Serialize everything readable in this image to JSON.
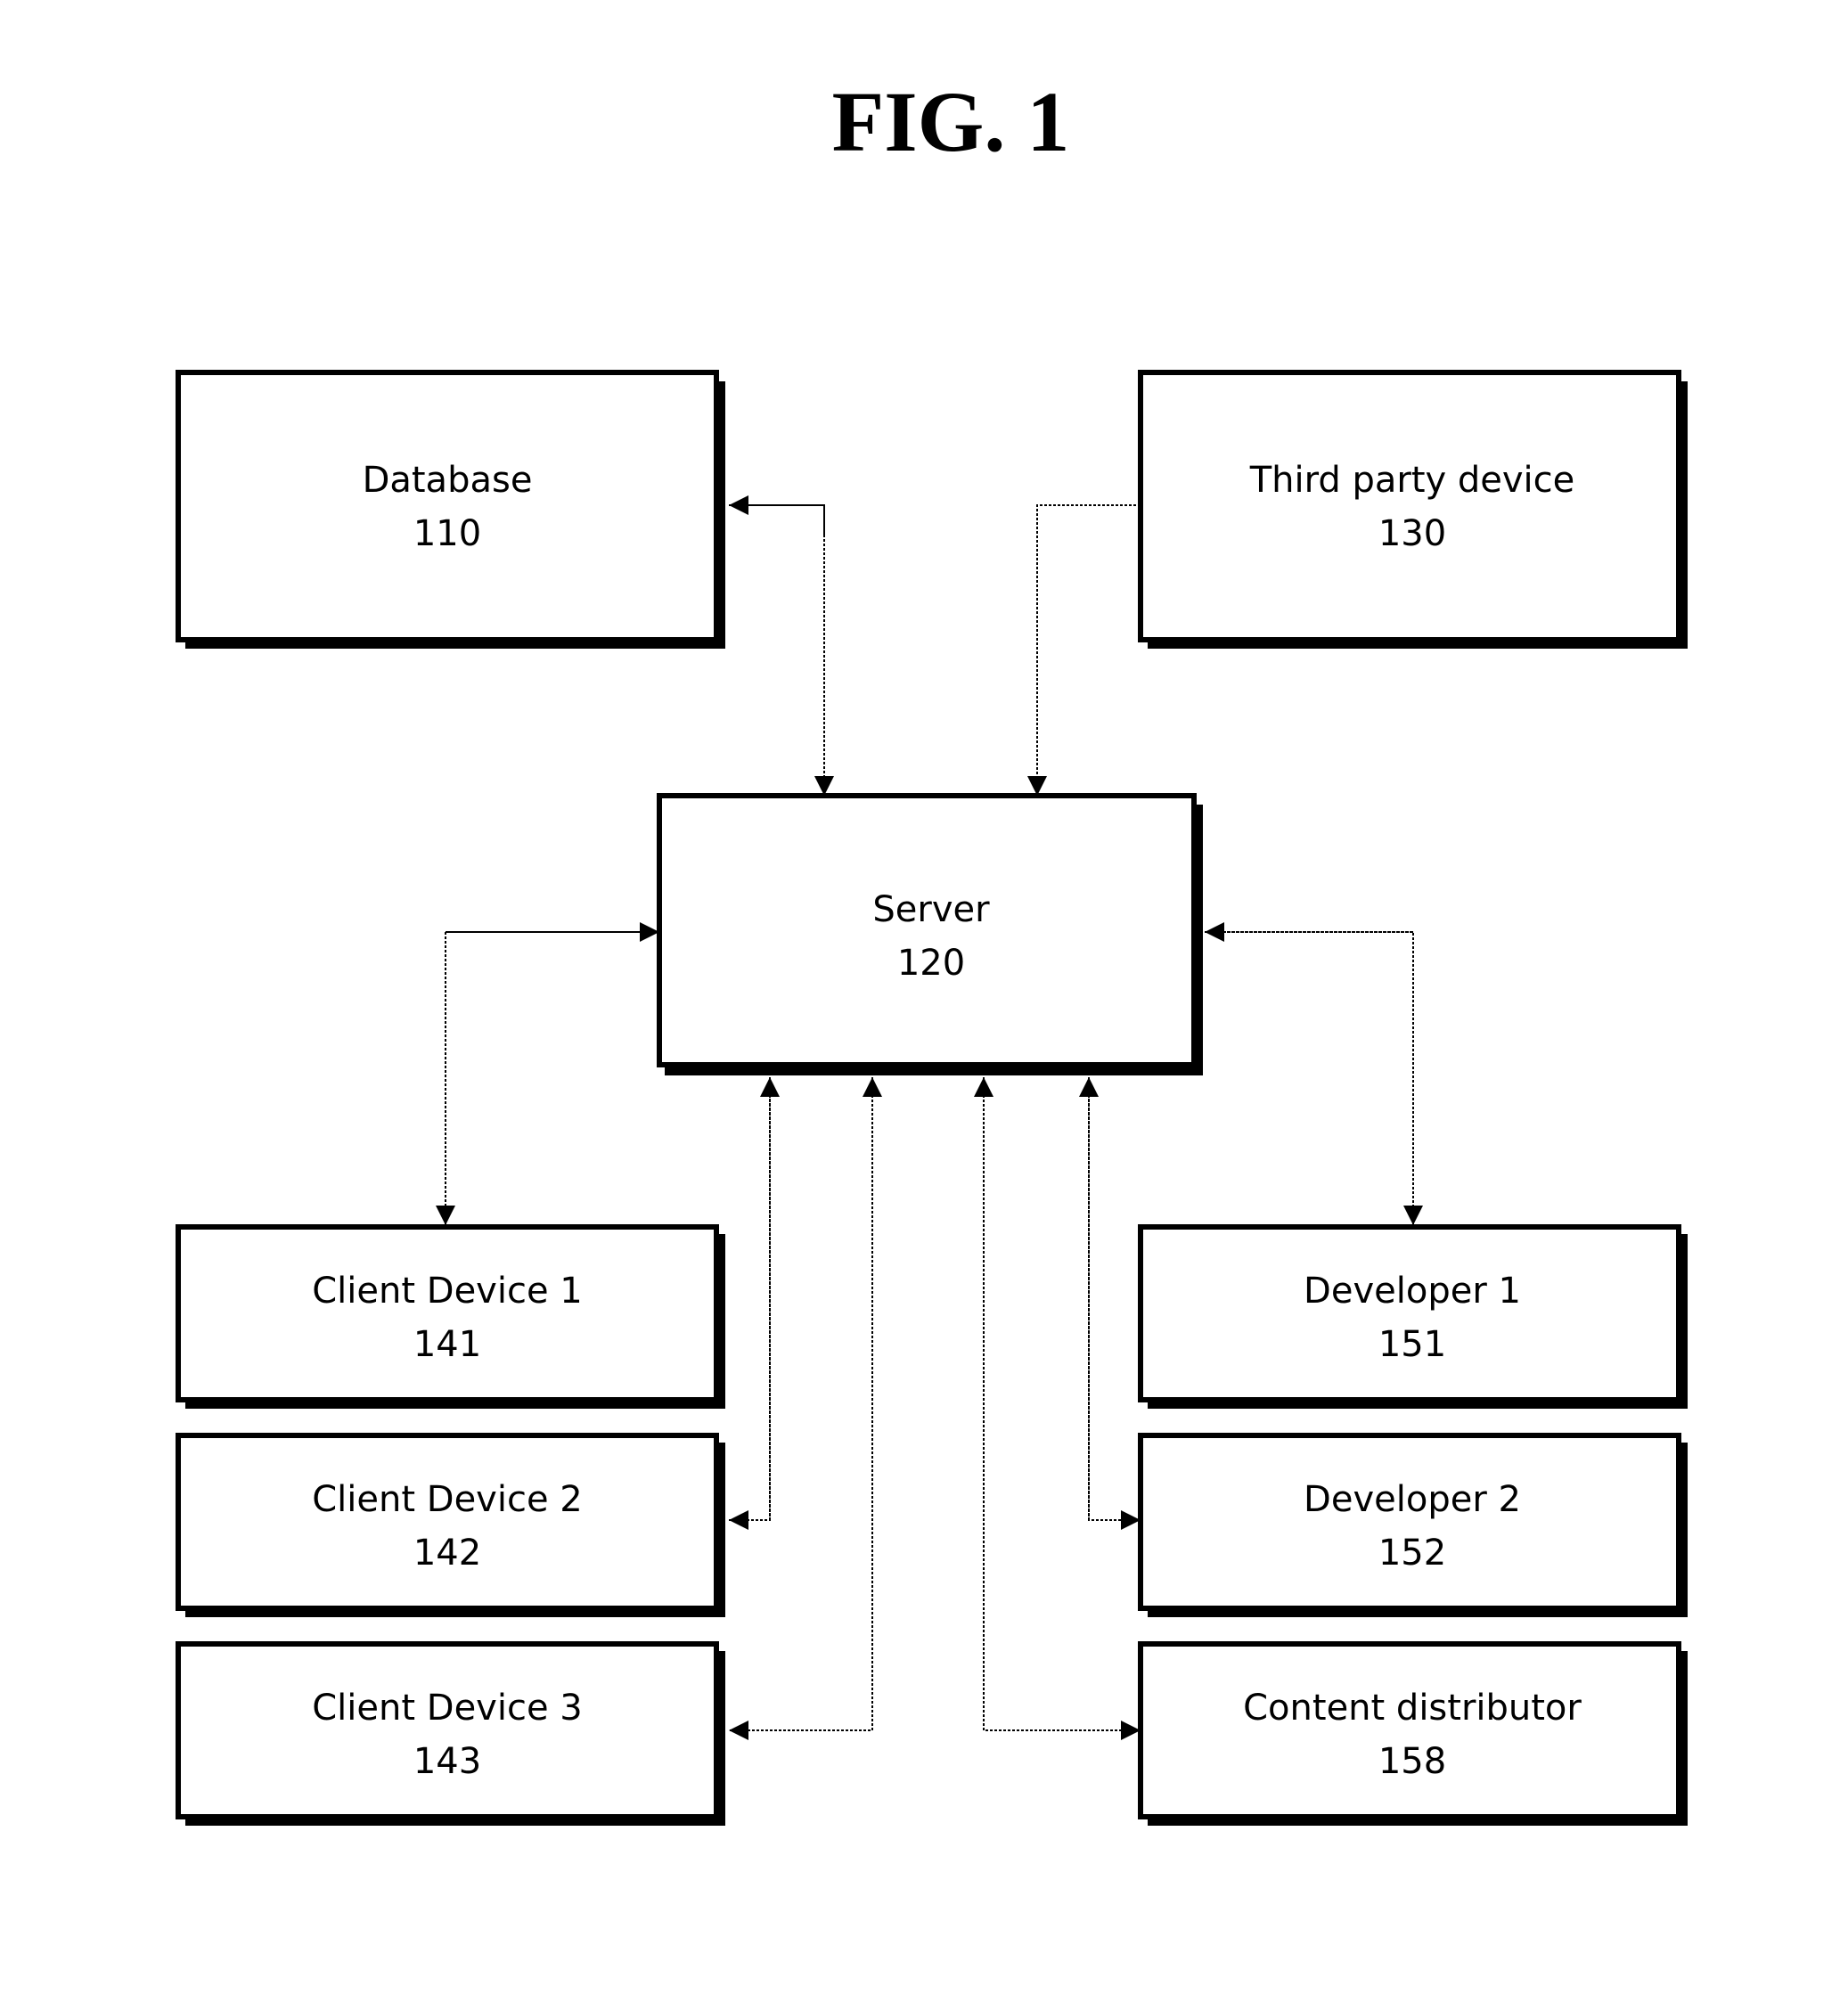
{
  "figure": {
    "title": "FIG. 1"
  },
  "nodes": {
    "database": {
      "name": "Database",
      "ref": "110"
    },
    "third_party": {
      "name": "Third party device",
      "ref": "130"
    },
    "server": {
      "name": "Server",
      "ref": "120"
    },
    "client1": {
      "name": "Client Device 1",
      "ref": "141"
    },
    "client2": {
      "name": "Client Device 2",
      "ref": "142"
    },
    "client3": {
      "name": "Client Device 3",
      "ref": "143"
    },
    "developer1": {
      "name": "Developer 1",
      "ref": "151"
    },
    "developer2": {
      "name": "Developer 2",
      "ref": "152"
    },
    "content_distributor": {
      "name": "Content distributor",
      "ref": "158"
    }
  },
  "connections": [
    {
      "from": "database",
      "to": "server",
      "direction": "bidirectional"
    },
    {
      "from": "third_party",
      "to": "server",
      "direction": "one-way"
    },
    {
      "from": "server",
      "to": "client1",
      "direction": "bidirectional"
    },
    {
      "from": "server",
      "to": "client2",
      "direction": "bidirectional"
    },
    {
      "from": "server",
      "to": "client3",
      "direction": "bidirectional"
    },
    {
      "from": "server",
      "to": "developer1",
      "direction": "bidirectional"
    },
    {
      "from": "server",
      "to": "developer2",
      "direction": "bidirectional"
    },
    {
      "from": "server",
      "to": "content_distributor",
      "direction": "bidirectional"
    }
  ]
}
